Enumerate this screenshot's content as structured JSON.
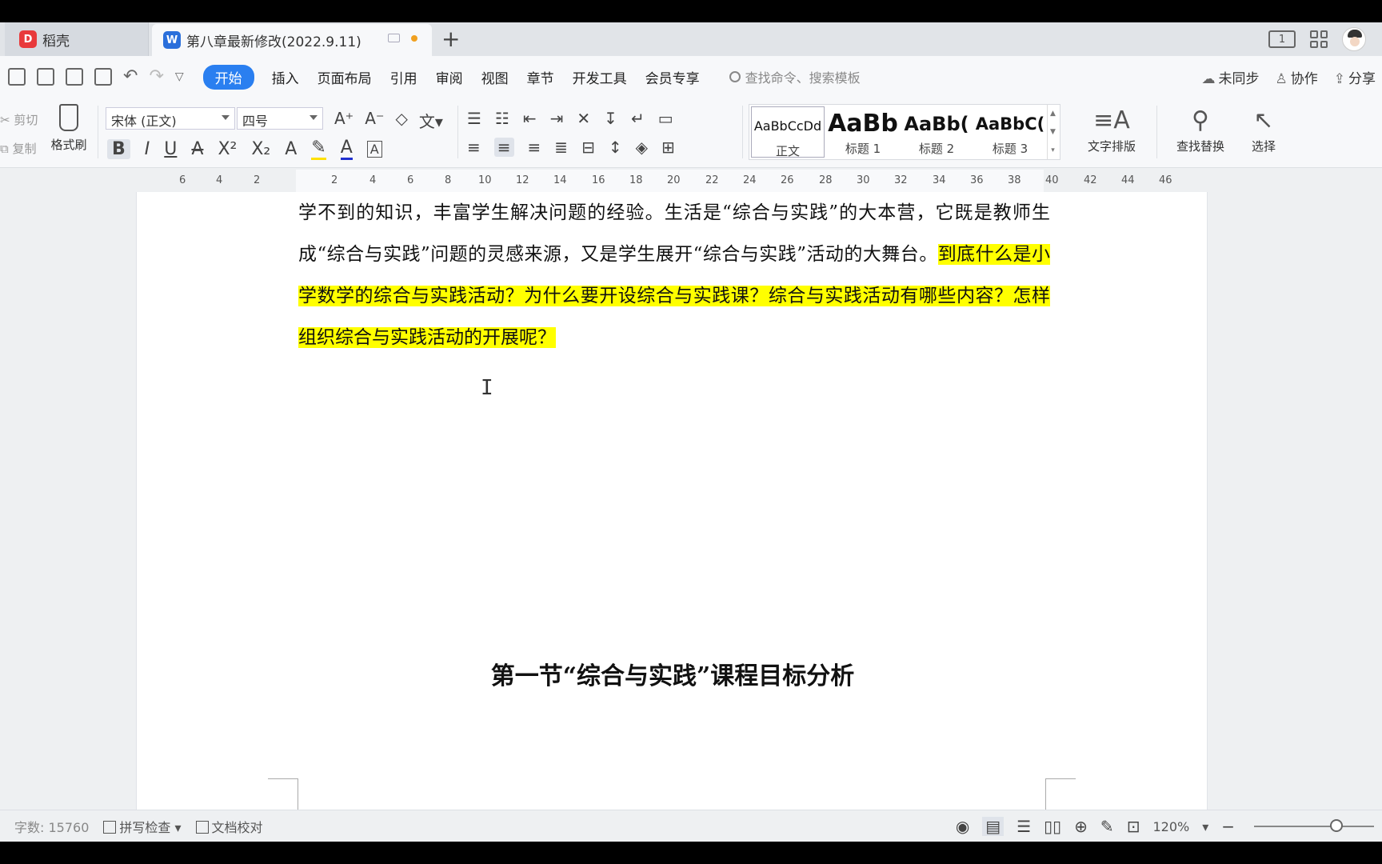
{
  "tabs": {
    "home_tab": "稻壳",
    "doc_tab": "第八章最新修改(2022.9.11)",
    "window_label": "1"
  },
  "menu": {
    "items": [
      "开始",
      "插入",
      "页面布局",
      "引用",
      "审阅",
      "视图",
      "章节",
      "开发工具",
      "会员专享"
    ],
    "search_placeholder": "查找命令、搜索模板",
    "sync": "未同步",
    "collab": "协作",
    "share": "分享"
  },
  "ribbon": {
    "cut": "剪切",
    "copy": "复制",
    "format_painter": "格式刷",
    "font_name": "宋体 (正文)",
    "font_size": "四号",
    "styles": [
      {
        "preview": "AaBbCcDd",
        "name": "正文"
      },
      {
        "preview": "AaBb",
        "name": "标题 1"
      },
      {
        "preview": "AaBb(",
        "name": "标题 2"
      },
      {
        "preview": "AaBbC(",
        "name": "标题 3"
      }
    ],
    "text_layout": "文字排版",
    "find_replace": "查找替换",
    "select": "选择"
  },
  "ruler": {
    "ticks": [
      "6",
      "4",
      "2",
      "2",
      "4",
      "6",
      "8",
      "10",
      "12",
      "14",
      "16",
      "18",
      "20",
      "22",
      "24",
      "26",
      "28",
      "30",
      "32",
      "34",
      "36",
      "38",
      "40",
      "42",
      "44",
      "46"
    ]
  },
  "document": {
    "para_plain": "学不到的知识，丰富学生解决问题的经验。生活是“综合与实践”的大本营，它既是教师生成“综合与实践”问题的灵感来源，又是学生展开“综合与实践”活动的大舞台。",
    "para_highlight": "到底什么是小学数学的综合与实践活动？为什么要开设综合与实践课？综合与实践活动有哪些内容？怎样组织综合与实践活动的开展呢？",
    "heading": "第一节“综合与实践”课程目标分析",
    "highlight_color": "#ffff00"
  },
  "status": {
    "word_count": "字数: 15760",
    "spell_check": "拼写检查",
    "doc_proof": "文档校对",
    "zoom": "120%"
  },
  "colors": {
    "accent": "#2a7ff0"
  }
}
